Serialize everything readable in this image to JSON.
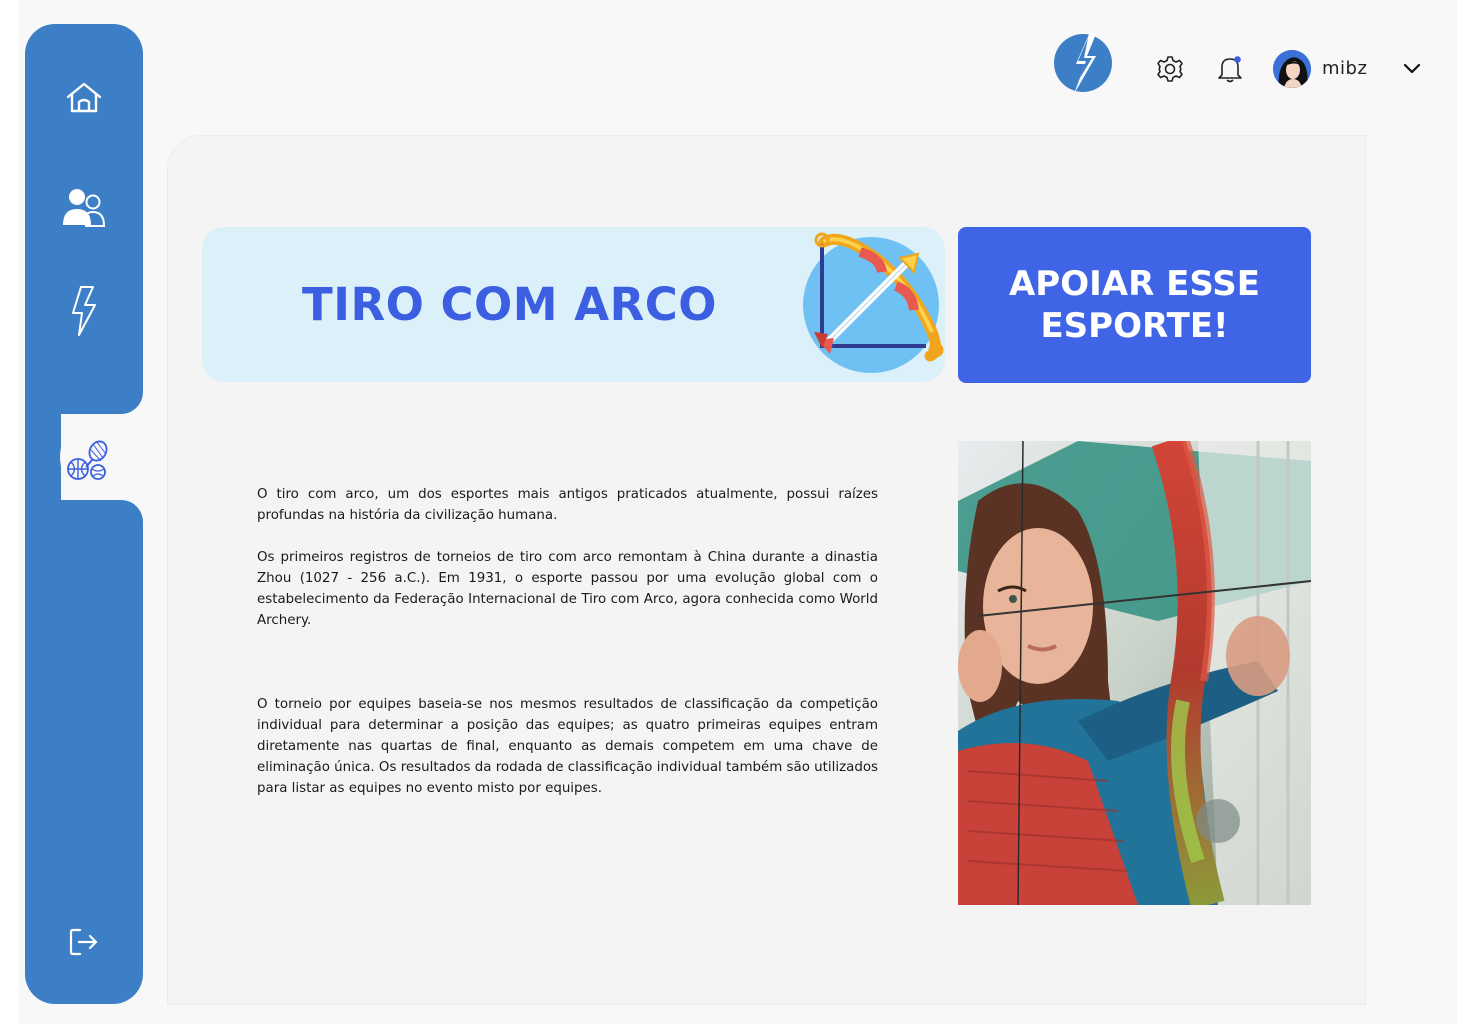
{
  "header": {
    "username": "mibz"
  },
  "sidebar": {
    "items": [
      {
        "name": "home",
        "icon": "home-icon",
        "active": false
      },
      {
        "name": "users",
        "icon": "users-icon",
        "active": false
      },
      {
        "name": "energy",
        "icon": "lightning-icon",
        "active": false
      },
      {
        "name": "sports",
        "icon": "sports-balls-icon",
        "active": true
      },
      {
        "name": "logout",
        "icon": "logout-icon",
        "active": false
      }
    ]
  },
  "main": {
    "title": "TIRO COM ARCO",
    "support_button_label": "APOIAR ESSE ESPORTE!",
    "paragraphs": [
      "O tiro com arco, um dos esportes mais antigos praticados atualmente, possui raízes profundas na história da civilização humana.",
      "Os primeiros registros de torneios de tiro com arco remontam à China durante a dinastia Zhou (1027 - 256 a.C.). Em 1931, o esporte passou por uma evolução global com o estabelecimento da Federação Internacional de Tiro com Arco, agora conhecida como World Archery.",
      "O torneio por equipes baseia-se nos mesmos resultados de classificação da competição individual para determinar a posição das equipes; as quatro primeiras equipes entram diretamente nas quartas de final, enquanto as demais competem em uma chave de eliminação única. Os resultados da rodada de classificação individual também são utilizados para listar as equipes no evento misto por equipes."
    ]
  },
  "colors": {
    "sidebar": "#3d7fc6",
    "accent": "#3f65e6",
    "title": "#3b5fe0",
    "title_card": "#dcf0fa"
  }
}
